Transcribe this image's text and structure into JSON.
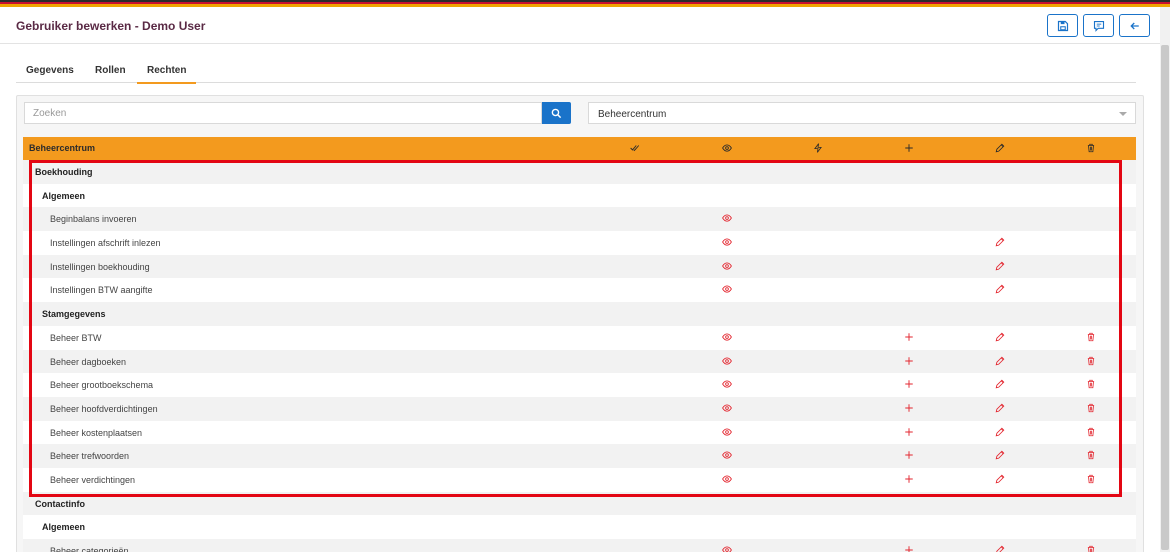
{
  "header": {
    "title": "Gebruiker bewerken - Demo User",
    "buttons": [
      {
        "icon": "save-icon"
      },
      {
        "icon": "comment-icon"
      },
      {
        "icon": "arrow-left-icon"
      }
    ]
  },
  "tabs": [
    {
      "label": "Gegevens",
      "active": false
    },
    {
      "label": "Rollen",
      "active": false
    },
    {
      "label": "Rechten",
      "active": true
    }
  ],
  "search": {
    "placeholder": "Zoeken",
    "value": ""
  },
  "select": {
    "value": "Beheercentrum"
  },
  "table": {
    "header_label": "Beheercentrum",
    "columns": [
      {
        "icon": "double-check-icon"
      },
      {
        "icon": "eye-icon"
      },
      {
        "icon": "bolt-icon"
      },
      {
        "icon": "plus-icon"
      },
      {
        "icon": "pencil-icon"
      },
      {
        "icon": "trash-icon"
      }
    ],
    "rows": [
      {
        "label": "Boekhouding",
        "level": 0,
        "icons": []
      },
      {
        "label": "Algemeen",
        "level": 1,
        "icons": []
      },
      {
        "label": "Beginbalans invoeren",
        "level": 2,
        "icons": [
          "eye"
        ]
      },
      {
        "label": "Instellingen afschrift inlezen",
        "level": 2,
        "icons": [
          "eye",
          "pencil"
        ]
      },
      {
        "label": "Instellingen boekhouding",
        "level": 2,
        "icons": [
          "eye",
          "pencil"
        ]
      },
      {
        "label": "Instellingen BTW aangifte",
        "level": 2,
        "icons": [
          "eye",
          "pencil"
        ]
      },
      {
        "label": "Stamgegevens",
        "level": 1,
        "icons": []
      },
      {
        "label": "Beheer BTW",
        "level": 2,
        "icons": [
          "eye",
          "plus",
          "pencil",
          "trash"
        ]
      },
      {
        "label": "Beheer dagboeken",
        "level": 2,
        "icons": [
          "eye",
          "plus",
          "pencil",
          "trash"
        ]
      },
      {
        "label": "Beheer grootboekschema",
        "level": 2,
        "icons": [
          "eye",
          "plus",
          "pencil",
          "trash"
        ]
      },
      {
        "label": "Beheer hoofdverdichtingen",
        "level": 2,
        "icons": [
          "eye",
          "plus",
          "pencil",
          "trash"
        ]
      },
      {
        "label": "Beheer kostenplaatsen",
        "level": 2,
        "icons": [
          "eye",
          "plus",
          "pencil",
          "trash"
        ]
      },
      {
        "label": "Beheer trefwoorden",
        "level": 2,
        "icons": [
          "eye",
          "plus",
          "pencil",
          "trash"
        ]
      },
      {
        "label": "Beheer verdichtingen",
        "level": 2,
        "icons": [
          "eye",
          "plus",
          "pencil",
          "trash"
        ]
      },
      {
        "label": "Contactinfo",
        "level": 0,
        "icons": []
      },
      {
        "label": "Algemeen",
        "level": 1,
        "icons": []
      },
      {
        "label": "Beheer categorieën",
        "level": 2,
        "icons": [
          "eye",
          "plus",
          "pencil",
          "trash"
        ]
      }
    ]
  },
  "colors": {
    "accent_orange": "#f39a1e",
    "primary_blue": "#1a73c9",
    "icon_red": "#e3262f",
    "highlight_red": "#e30613",
    "title_color": "#5a2a45"
  }
}
